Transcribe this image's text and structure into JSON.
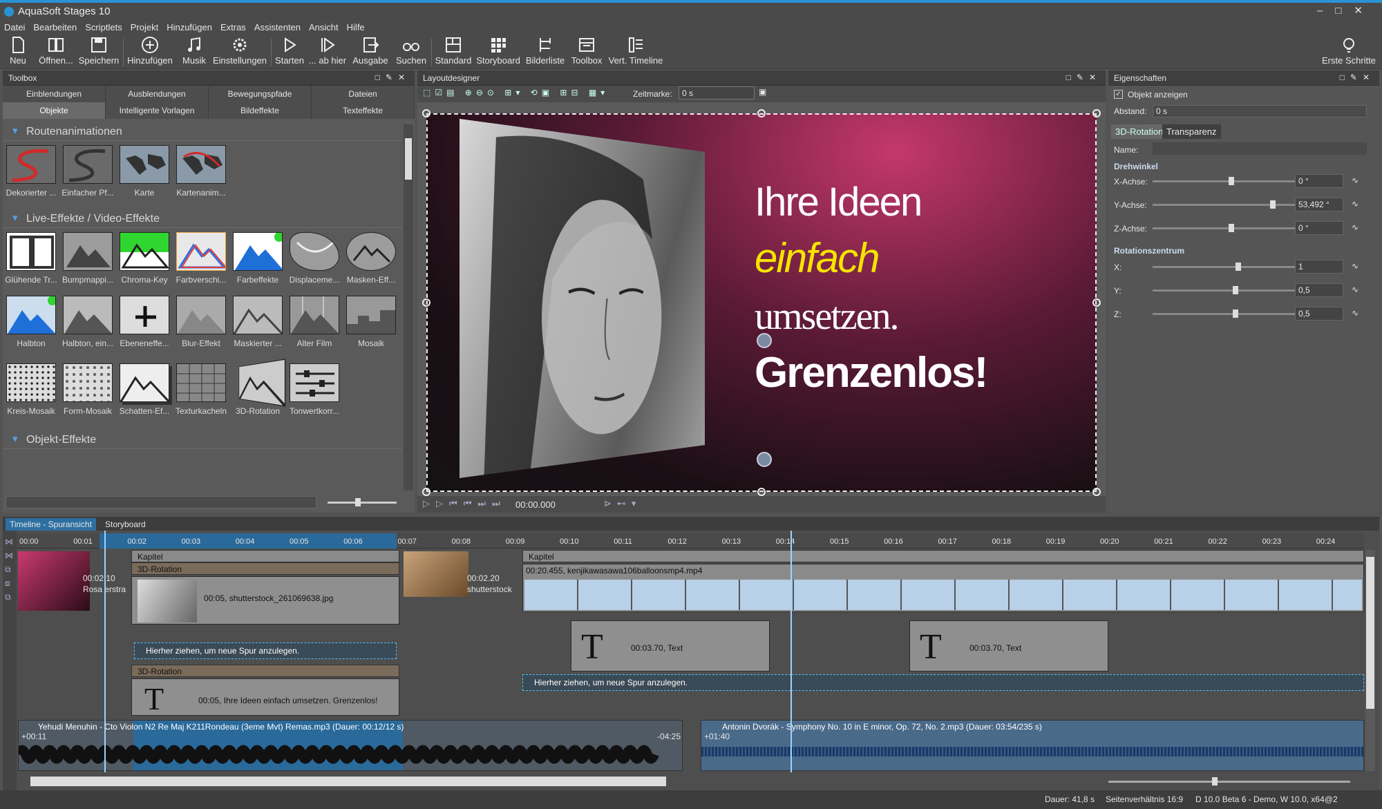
{
  "app": {
    "title": "AquaSoft Stages 10"
  },
  "menu": [
    "Datei",
    "Bearbeiten",
    "Scriptlets",
    "Projekt",
    "Hinzufügen",
    "Extras",
    "Assistenten",
    "Ansicht",
    "Hilfe"
  ],
  "toolbar": {
    "new": "Neu",
    "open": "Öffnen...",
    "save": "Speichern",
    "add": "Hinzufügen",
    "music": "Musik",
    "settings": "Einstellungen",
    "start": "Starten",
    "start_here": "... ab hier",
    "output": "Ausgabe",
    "search": "Suchen",
    "standard": "Standard",
    "storyboard": "Storyboard",
    "image_list": "Bilderliste",
    "toolbox": "Toolbox",
    "vert_timeline": "Vert. Timeline",
    "first_steps": "Erste Schritte"
  },
  "toolbox": {
    "title": "Toolbox",
    "tabs_top": [
      "Einblendungen",
      "Ausblendungen",
      "Bewegungspfade",
      "Dateien"
    ],
    "tabs_bottom": [
      "Objekte",
      "Intelligente Vorlagen",
      "Bildeffekte",
      "Texteffekte"
    ],
    "cat1": "Routenanimationen",
    "cat1_items": [
      "Dekorierter ...",
      "Einfacher Pf...",
      "Karte",
      "Kartenanim..."
    ],
    "cat2": "Live-Effekte / Video-Effekte",
    "row1": [
      "Glühende Tr...",
      "Bumpmappi...",
      "Chroma-Key",
      "Farbverschi...",
      "Farbeffekte",
      "Displaceme...",
      "Masken-Eff..."
    ],
    "row2": [
      "Halbton",
      "Halbton, ein...",
      "Ebeneneffe...",
      "Blur-Effekt",
      "Maskierter ...",
      "Alter Film",
      "Mosaik"
    ],
    "row3": [
      "Kreis-Mosaik",
      "Form-Mosaik",
      "Schatten-Ef...",
      "Texturkacheln",
      "3D-Rotation",
      "Tonwertkorr..."
    ],
    "cat3": "Objekt-Effekte"
  },
  "layout": {
    "title": "Layoutdesigner",
    "zeitmarke_label": "Zeitmarke:",
    "zeitmarke_value": "0 s",
    "slide_text": [
      "Ihre Ideen",
      "einfach",
      "umsetzen.",
      "Grenzenlos!"
    ],
    "time": "00:00.000"
  },
  "props": {
    "title": "Eigenschaften",
    "show_object": "Objekt anzeigen",
    "abstand_label": "Abstand:",
    "abstand_value": "0 s",
    "tab1": "3D-Rotation",
    "tab2": "Transparenz",
    "name_label": "Name:",
    "drehwinkel": "Drehwinkel",
    "rows": [
      {
        "label": "X-Achse:",
        "value": "0 °",
        "pos": 0.55
      },
      {
        "label": "Y-Achse:",
        "value": "53,492 °",
        "pos": 0.85
      },
      {
        "label": "Z-Achse:",
        "value": "0 °",
        "pos": 0.55
      }
    ],
    "rotationszentrum": "Rotationszentrum",
    "rows2": [
      {
        "label": "X:",
        "value": "1",
        "pos": 0.6
      },
      {
        "label": "Y:",
        "value": "0,5",
        "pos": 0.58
      },
      {
        "label": "Z:",
        "value": "0,5",
        "pos": 0.58
      }
    ]
  },
  "timeline": {
    "tab1": "Timeline - Spuransicht",
    "tab2": "Storyboard",
    "ticks": [
      "00:00",
      "00:01",
      "00:02",
      "00:03",
      "00:04",
      "00:05",
      "00:06",
      "00:07",
      "00:08",
      "00:09",
      "00:10",
      "00:11",
      "00:12",
      "00:13",
      "00:14",
      "00:15",
      "00:16",
      "00:17",
      "00:18",
      "00:19",
      "00:20",
      "00:21",
      "00:22",
      "00:23",
      "00:24"
    ],
    "clip_rose_time": "00:02.10",
    "clip_rose_name": "Rosa erstra",
    "kapitel": "Kapitel",
    "rot3d": "3D-Rotation",
    "img_clip": "00:05, shutterstock_261069638.jpg",
    "photo_time": "00:02.20",
    "photo_name": "shutterstock",
    "drop_text": "Hierher ziehen, um neue Spur anzulegen.",
    "text_clip": "00:05, Ihre Ideen einfach umsetzen. Grenzenlos!",
    "video_clip": "00:20.455,  kenjikawasawa106balloonsmp4.mp4",
    "text1": "00:03.70, Text",
    "text2": "00:03.70, Text",
    "audio1": "Yehudi Menuhin - Cto Violon N2 Re Maj K211Rondeau (3eme Mvt) Remas.mp3 (Dauer: 00:12/12 s)",
    "audio1_offset": "+00:11",
    "audio1_end": "-04:25",
    "audio2": "Antonin Dvorák  - Symphony No. 10 in E minor, Op. 72, No. 2.mp3 (Dauer: 03:54/235 s)",
    "audio2_offset": "+01:40"
  },
  "status": {
    "duration": "Dauer: 41,8 s",
    "ratio": "Seitenverhältnis 16:9",
    "version": "D 10.0 Beta 6 - Demo, W 10.0, x64@2"
  }
}
